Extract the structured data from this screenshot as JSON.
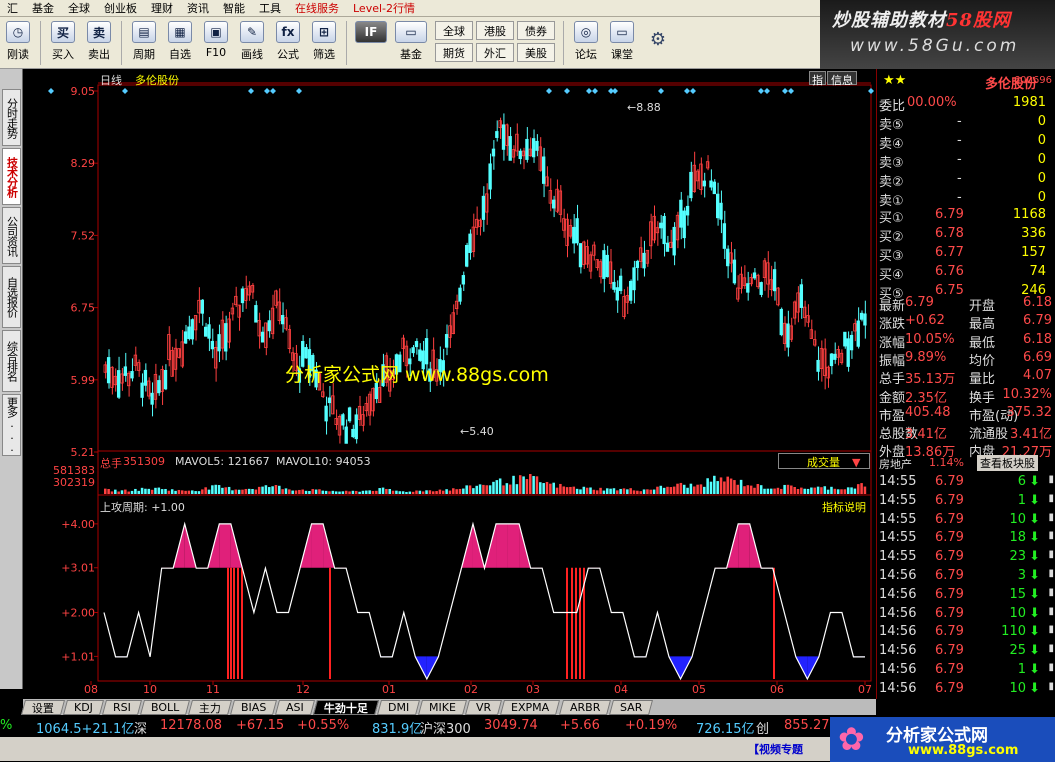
{
  "menu": [
    {
      "label": "汇",
      "hot": false
    },
    {
      "label": "基金",
      "hot": false
    },
    {
      "label": "全球",
      "hot": false
    },
    {
      "label": "创业板",
      "hot": false
    },
    {
      "label": "理财",
      "hot": false
    },
    {
      "label": "资讯",
      "hot": false
    },
    {
      "label": "智能",
      "hot": false
    },
    {
      "label": "工具",
      "hot": false
    },
    {
      "label": "在线服务",
      "hot": true
    },
    {
      "label": "Level-2行情",
      "hot": true
    }
  ],
  "toolbar": {
    "buttons": [
      {
        "icon": "clock-icon",
        "glyph": "◷",
        "label": "刚读"
      },
      {
        "icon": "buy-icon",
        "glyph": "买",
        "label": "买入"
      },
      {
        "icon": "sell-icon",
        "glyph": "卖",
        "label": "卖出"
      },
      {
        "icon": "period-icon",
        "glyph": "▤",
        "label": "周期"
      },
      {
        "icon": "watchlist-icon",
        "glyph": "▦",
        "label": "自选"
      },
      {
        "icon": "f10-icon",
        "glyph": "▣",
        "label": "F10"
      },
      {
        "icon": "draw-icon",
        "glyph": "✎",
        "label": "画线"
      },
      {
        "icon": "formula-icon",
        "glyph": "fx",
        "label": "公式"
      },
      {
        "icon": "screen-icon",
        "glyph": "⊞",
        "label": "筛选"
      }
    ],
    "if_button": {
      "glyph": "IF",
      "label": ""
    },
    "fund_button": {
      "glyph": "▭",
      "label": "基金"
    },
    "quick": [
      "全球",
      "港股",
      "债券",
      "期货",
      "外汇",
      "美股"
    ],
    "right_buttons": [
      {
        "icon": "forum-icon",
        "glyph": "◎",
        "label": "论坛"
      },
      {
        "icon": "class-icon",
        "glyph": "▭",
        "label": "课堂"
      }
    ],
    "settings_icon": "gear-icon"
  },
  "banner": {
    "line1_a": "炒股辅助教材",
    "line1_b": "58股网",
    "line2": "www.58Gu.com"
  },
  "left_tabs": [
    {
      "label": "分时走势",
      "active": false
    },
    {
      "label": "技术分析",
      "active": true
    },
    {
      "label": "公司资讯",
      "active": false
    },
    {
      "label": "自选报价",
      "active": false
    },
    {
      "label": "综合排名",
      "active": false
    },
    {
      "label": "更多...",
      "active": false
    }
  ],
  "main_chart": {
    "period_label": "日线",
    "stock_name": "多伦股份",
    "right_tags": [
      "指",
      "信息"
    ],
    "watermark": "分析家公式网  www.88gs.com",
    "high_label": "8.88",
    "low_label": "5.40"
  },
  "volume_panel": {
    "label": "总手",
    "value": "351309",
    "mavol5": "MAVOL5: 121667",
    "mavol10": "MAVOL10: 94053",
    "dropdown": "成交量",
    "ticks": [
      "581383",
      "302319"
    ]
  },
  "indicator_panel": {
    "title": "上攻周期: +1.00",
    "button": "指标说明",
    "ticks": [
      "+4.00",
      "+3.01",
      "+2.00",
      "+1.01"
    ]
  },
  "x_axis": {
    "labels": [
      "08",
      "10",
      "11",
      "12",
      "01",
      "02",
      "03",
      "04",
      "05",
      "06",
      "07"
    ]
  },
  "chart_data": [
    {
      "type": "candlestick",
      "title": "多伦股份 日线",
      "y_ticks": [
        "9.05",
        "8.29",
        "7.52",
        "6.75",
        "5.99",
        "5.21"
      ],
      "ylim": [
        5.21,
        9.05
      ],
      "annotations": [
        {
          "label": "8.88",
          "value": 8.88
        },
        {
          "label": "5.40",
          "value": 5.4
        }
      ],
      "x_months": [
        "08",
        "10",
        "11",
        "12",
        "01",
        "02",
        "03",
        "04",
        "05",
        "06",
        "07"
      ],
      "trend_anchors": [
        6.1,
        6.0,
        6.1,
        5.7,
        6.2,
        6.4,
        6.8,
        6.2,
        6.6,
        7.0,
        6.5,
        6.8,
        6.1,
        6.2,
        5.7,
        5.5,
        5.5,
        5.9,
        6.0,
        6.3,
        6.2,
        6.1,
        6.5,
        7.5,
        7.8,
        8.7,
        8.4,
        8.5,
        8.0,
        7.7,
        7.4,
        7.3,
        7.0,
        6.8,
        7.3,
        7.6,
        7.4,
        8.0,
        8.2,
        7.6,
        6.9,
        7.0,
        7.1,
        6.5,
        6.8,
        6.2,
        6.1,
        6.4,
        6.7
      ]
    },
    {
      "type": "bar",
      "title": "成交量",
      "ticks": [
        "581383",
        "302319"
      ],
      "trend_anchors": [
        0.25,
        0.2,
        0.3,
        0.35,
        0.2,
        0.25,
        0.45,
        0.3,
        0.35,
        0.5,
        0.3,
        0.25,
        0.2,
        0.15,
        0.2,
        0.3,
        0.15,
        0.2,
        0.25,
        0.3,
        0.5,
        0.7,
        0.85,
        0.95,
        0.6,
        0.4,
        0.35,
        0.3,
        0.3,
        0.25,
        0.4,
        0.55,
        0.5,
        0.95,
        0.8,
        0.5,
        0.4,
        0.45,
        0.35,
        0.4,
        0.35,
        0.6
      ]
    },
    {
      "type": "line",
      "title": "上攻周期",
      "ticks": [
        "+4.00",
        "+3.01",
        "+2.00",
        "+1.01"
      ],
      "ylim": [
        0.5,
        4.2
      ],
      "series_anchors": [
        2,
        1,
        1,
        2,
        1,
        3,
        3,
        4,
        3,
        3,
        4,
        4,
        3,
        2,
        3,
        2,
        2,
        3,
        4,
        4,
        3,
        3,
        2,
        2,
        1,
        1,
        2,
        1,
        0.5,
        1,
        2,
        3,
        4,
        3,
        4,
        4,
        4,
        3,
        3,
        2,
        2,
        2,
        3,
        3,
        2,
        2,
        1,
        1,
        2,
        1,
        0.5,
        1,
        2,
        3,
        3,
        4,
        4,
        3,
        3,
        2,
        1,
        0.5,
        1,
        2,
        2,
        1,
        1
      ]
    }
  ],
  "right_panel": {
    "stars": "★★",
    "name": "多伦股份",
    "code": "600696",
    "weibi": {
      "label": "委比",
      "value": "00.00%",
      "num": "1981"
    },
    "sell": [
      {
        "label": "卖⑤",
        "price": "-",
        "vol": "0"
      },
      {
        "label": "卖④",
        "price": "-",
        "vol": "0"
      },
      {
        "label": "卖③",
        "price": "-",
        "vol": "0"
      },
      {
        "label": "卖②",
        "price": "-",
        "vol": "0"
      },
      {
        "label": "卖①",
        "price": "-",
        "vol": "0"
      }
    ],
    "buy": [
      {
        "label": "买①",
        "price": "6.79",
        "vol": "1168"
      },
      {
        "label": "买②",
        "price": "6.78",
        "vol": "336"
      },
      {
        "label": "买③",
        "price": "6.77",
        "vol": "157"
      },
      {
        "label": "买④",
        "price": "6.76",
        "vol": "74"
      },
      {
        "label": "买⑤",
        "price": "6.75",
        "vol": "246"
      }
    ],
    "stats": [
      {
        "l1": "最新",
        "v1": "6.79",
        "l2": "开盘",
        "v2": "6.18"
      },
      {
        "l1": "涨跌",
        "v1": "+0.62",
        "l2": "最高",
        "v2": "6.79"
      },
      {
        "l1": "涨幅",
        "v1": "10.05%",
        "l2": "最低",
        "v2": "6.18"
      },
      {
        "l1": "振幅",
        "v1": "9.89%",
        "l2": "均价",
        "v2": "6.69"
      },
      {
        "l1": "总手",
        "v1": "35.13万",
        "l2": "量比",
        "v2": "4.07"
      },
      {
        "l1": "金额",
        "v1": "2.35亿",
        "l2": "换手",
        "v2": "10.32%"
      },
      {
        "l1": "市盈",
        "v1": "405.48",
        "l2": "市盈(动)",
        "v2": "375.32"
      },
      {
        "l1": "总股数",
        "v1": "3.41亿",
        "l2": "流通股",
        "v2": "3.41亿"
      },
      {
        "l1": "外盘",
        "v1": "13.86万",
        "l2": "内盘",
        "v2": "21.27万"
      }
    ],
    "sector": {
      "name": "房地产",
      "pct": "1.14%",
      "button": "查看板块股"
    },
    "ticks": [
      {
        "time": "14:55",
        "price": "6.79",
        "vol": "6"
      },
      {
        "time": "14:55",
        "price": "6.79",
        "vol": "1"
      },
      {
        "time": "14:55",
        "price": "6.79",
        "vol": "10"
      },
      {
        "time": "14:55",
        "price": "6.79",
        "vol": "18"
      },
      {
        "time": "14:55",
        "price": "6.79",
        "vol": "23"
      },
      {
        "time": "14:56",
        "price": "6.79",
        "vol": "3"
      },
      {
        "time": "14:56",
        "price": "6.79",
        "vol": "15"
      },
      {
        "time": "14:56",
        "price": "6.79",
        "vol": "10"
      },
      {
        "time": "14:56",
        "price": "6.79",
        "vol": "110"
      },
      {
        "time": "14:56",
        "price": "6.79",
        "vol": "25"
      },
      {
        "time": "14:56",
        "price": "6.79",
        "vol": "1"
      },
      {
        "time": "14:56",
        "price": "6.79",
        "vol": "10"
      }
    ]
  },
  "bottom_tabs": [
    {
      "label": "设置",
      "active": false
    },
    {
      "label": "KDJ",
      "active": false
    },
    {
      "label": "RSI",
      "active": false
    },
    {
      "label": "BOLL",
      "active": false
    },
    {
      "label": "主力",
      "active": false
    },
    {
      "label": "BIAS",
      "active": false
    },
    {
      "label": "ASI",
      "active": false
    },
    {
      "label": "牛劲十足",
      "active": true
    },
    {
      "label": "DMI",
      "active": false
    },
    {
      "label": "MIKE",
      "active": false
    },
    {
      "label": "VR",
      "active": false
    },
    {
      "label": "EXPMA",
      "active": false
    },
    {
      "label": "ARBR",
      "active": false
    },
    {
      "label": "SAR",
      "active": false
    }
  ],
  "status": {
    "s1": "%",
    "s2": "1064.5+21.1亿",
    "s3": "深",
    "s4": "12178.08",
    "s5": "+67.15",
    "s6": "+0.55%",
    "s7": "831.9亿",
    "s8": "沪深300",
    "s9": "3049.74",
    "s10": "+5.66",
    "s11": "+0.19%",
    "s12": "726.15亿",
    "s13": "创",
    "s14": "855.27",
    "video": "【视频专题",
    "logo": "分析家公式网",
    "logo_url": "www.88gs.com"
  }
}
